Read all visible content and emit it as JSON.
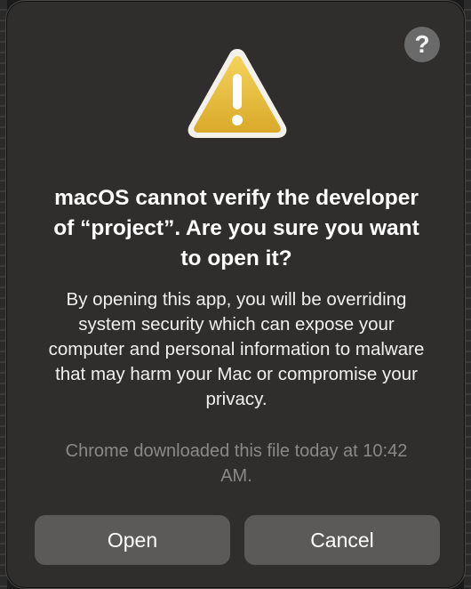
{
  "dialog": {
    "help_label": "?",
    "title": "macOS cannot verify the developer of “project”. Are you sure you want to open it?",
    "body": "By opening this app, you will be overriding system security which can expose your computer and personal information to malware that may harm your Mac or compromise your privacy.",
    "meta": "Chrome downloaded this file today at 10:42 AM.",
    "buttons": {
      "open": "Open",
      "cancel": "Cancel"
    },
    "icon": "warning-triangle-icon"
  },
  "colors": {
    "dialog_bg": "#2f2e2d",
    "button_bg": "#5b5a58",
    "warning_yellow": "#e8c13c",
    "meta_text": "#8a8987"
  }
}
